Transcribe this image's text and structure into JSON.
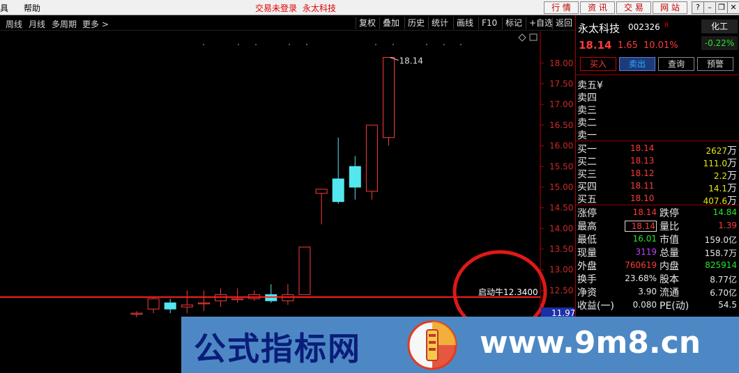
{
  "menu": {
    "item1": "具",
    "item2": "帮助"
  },
  "top_status": {
    "login": "交易未登录",
    "stock": "永太科技"
  },
  "top_buttons": [
    "行 情",
    "资 讯",
    "交 易",
    "网 站"
  ],
  "window_controls": [
    "?",
    "–",
    "❐",
    "✕"
  ],
  "toolbar_left": [
    "周线",
    "月线",
    "多周期",
    "更多 >"
  ],
  "toolbar_right": [
    "复权",
    "叠加",
    "历史",
    "统计",
    "画线",
    "F10",
    "标记",
    "+自选",
    "返回"
  ],
  "chart_data": {
    "type": "candlestick",
    "y_ticks": [
      "18.00",
      "17.50",
      "17.00",
      "16.50",
      "16.00",
      "15.50",
      "15.00",
      "14.50",
      "14.00",
      "13.50",
      "13.00",
      "12.50"
    ],
    "y_range": [
      11.9,
      18.3
    ],
    "candles": [
      {
        "open": 11.95,
        "close": 11.95,
        "high": 12.0,
        "low": 11.85
      },
      {
        "open": 12.05,
        "close": 12.3,
        "high": 12.32,
        "low": 11.95
      },
      {
        "open": 12.2,
        "close": 12.05,
        "high": 12.3,
        "low": 11.95
      },
      {
        "open": 12.1,
        "close": 12.15,
        "high": 12.5,
        "low": 11.95
      },
      {
        "open": 12.2,
        "close": 12.2,
        "high": 12.5,
        "low": 12.0
      },
      {
        "open": 12.25,
        "close": 12.4,
        "high": 12.55,
        "low": 12.1
      },
      {
        "open": 12.3,
        "close": 12.3,
        "high": 12.55,
        "low": 12.2
      },
      {
        "open": 12.3,
        "close": 12.4,
        "high": 12.5,
        "low": 12.25
      },
      {
        "open": 12.4,
        "close": 12.25,
        "high": 12.65,
        "low": 12.2
      },
      {
        "open": 12.25,
        "close": 12.4,
        "high": 12.65,
        "low": 12.15
      },
      {
        "open": 12.4,
        "close": 13.55,
        "high": 13.55,
        "low": 12.4
      },
      {
        "open": 14.85,
        "close": 14.95,
        "high": 14.95,
        "low": 14.1
      },
      {
        "open": 15.2,
        "close": 14.65,
        "high": 16.2,
        "low": 14.6
      },
      {
        "open": 15.5,
        "close": 15.0,
        "high": 15.75,
        "low": 14.7
      },
      {
        "open": 14.9,
        "close": 16.5,
        "high": 16.5,
        "low": 14.7
      },
      {
        "open": 16.2,
        "close": 18.14,
        "high": 18.14,
        "low": 16.01
      }
    ],
    "annotations": {
      "high_label": "18.14",
      "start_label": "启动牛12.3400",
      "price_tag": "11.97"
    },
    "colors": {
      "up": "#ff3b3b",
      "down": "#53e8f0",
      "hline": "#ff2020"
    }
  },
  "quote": {
    "name": "永太科技",
    "code": "002326",
    "code_suffix": "R",
    "sector": "化工",
    "sector_change": "-0.22%",
    "price": "18.14",
    "change": "1.65",
    "change_pct": "10.01%",
    "buttons": [
      "买入",
      "卖出",
      "查询",
      "预警"
    ],
    "asks": [
      {
        "label": "卖五",
        "extra": "¥"
      },
      {
        "label": "卖四",
        "extra": ""
      },
      {
        "label": "卖三",
        "extra": ""
      },
      {
        "label": "卖二",
        "extra": ""
      },
      {
        "label": "卖一",
        "extra": ""
      }
    ],
    "bids": [
      {
        "label": "买一",
        "price": "18.14",
        "vol": "2627",
        "unit": "万"
      },
      {
        "label": "买二",
        "price": "18.13",
        "vol": "111.0",
        "unit": "万"
      },
      {
        "label": "买三",
        "price": "18.12",
        "vol": "2.2",
        "unit": "万"
      },
      {
        "label": "买四",
        "price": "18.11",
        "vol": "14.1",
        "unit": "万"
      },
      {
        "label": "买五",
        "price": "18.10",
        "vol": "407.6",
        "unit": "万"
      }
    ],
    "stats": [
      {
        "l1": "涨停",
        "v1": "18.14",
        "c1": "#ff3b3b",
        "l2": "跌停",
        "v2": "14.84",
        "c2": "#29e529"
      },
      {
        "l1": "最高",
        "v1": "18.14",
        "c1": "#ff3b3b",
        "l2": "量比",
        "v2": "1.39",
        "c2": "#ff3b3b"
      },
      {
        "l1": "最低",
        "v1": "16.01",
        "c1": "#29e529",
        "l2": "市值",
        "v2": "159.0亿",
        "c2": "#e8e8e8"
      },
      {
        "l1": "现量",
        "v1": "3119",
        "c1": "#c040ff",
        "l2": "总量",
        "v2": "158.7万",
        "c2": "#e8e8e8"
      },
      {
        "l1": "外盘",
        "v1": "760619",
        "c1": "#ff3b3b",
        "l2": "内盘",
        "v2": "825914",
        "c2": "#29e529"
      },
      {
        "l1": "换手",
        "v1": "23.68%",
        "c1": "#e8e8e8",
        "l2": "股本",
        "v2": "8.77亿",
        "c2": "#e8e8e8"
      },
      {
        "l1": "净资",
        "v1": "3.90",
        "c1": "#e8e8e8",
        "l2": "流通",
        "v2": "6.70亿",
        "c2": "#e8e8e8"
      },
      {
        "l1": "收益(一)",
        "v1": "0.080",
        "c1": "#e8e8e8",
        "l2": "PE(动)",
        "v2": "54.5",
        "c2": "#e8e8e8"
      }
    ]
  },
  "banner": {
    "cn": "公式指标网",
    "url": "www.9m8.cn"
  }
}
